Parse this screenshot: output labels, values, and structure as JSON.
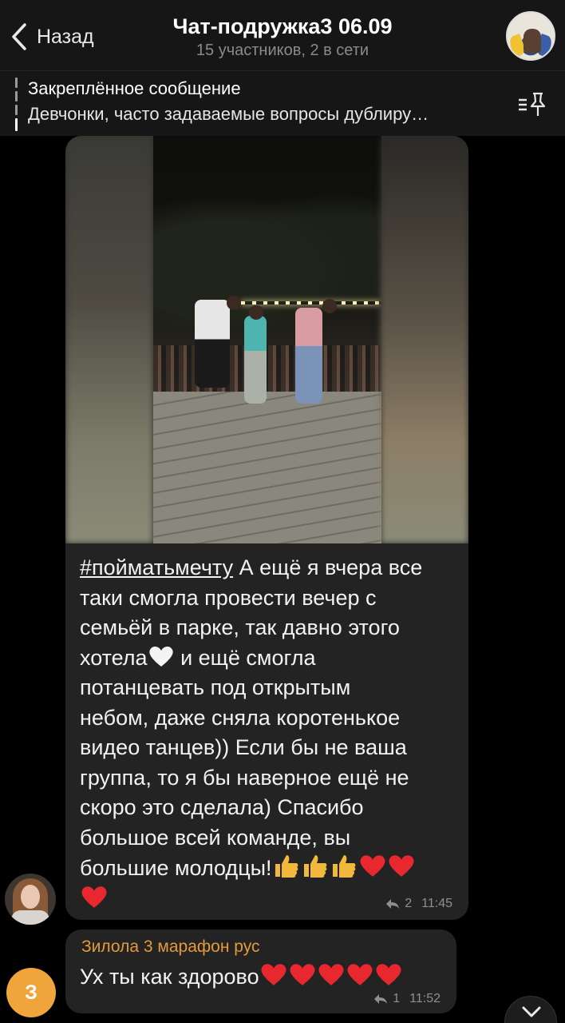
{
  "header": {
    "back_label": "Назад",
    "title": "Чат-подружка3 06.09",
    "subtitle": "15 участников, 2 в сети"
  },
  "pinned": {
    "title": "Закреплённое сообщение",
    "text": "Девчонки, часто задаваемые вопросы дублиру…"
  },
  "message": {
    "hashtag": "#поймать­мечту",
    "lines": [
      " А ещё я вчера все",
      "таки смогла провести вечер с",
      "семьёй в парке, так давно этого",
      "хотела",
      " и ещё смогла",
      "потанцевать под открытым",
      "небом, даже сняла коротенькое",
      "видео танцев)) Если бы не ваша",
      "группа, то я бы наверное ещё не",
      "скоро это сделала)  Спасибо",
      "большое всей команде, вы",
      "большие молодцы!"
    ],
    "reply_count": "2",
    "time": "11:45"
  },
  "reply": {
    "author": "Зилола 3 марафон рус",
    "text": "Ух ты  как здорово",
    "reply_count": "1",
    "time": "11:52",
    "avatar_letter": "З"
  },
  "colors": {
    "background": "#000000",
    "bubble": "#232323",
    "author_name": "#e49a3a",
    "avatar_letter_bg": "#f0a43c"
  }
}
